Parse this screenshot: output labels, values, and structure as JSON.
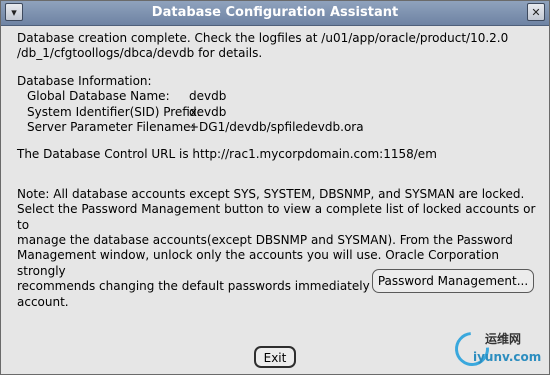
{
  "window": {
    "title": "Database Configuration Assistant"
  },
  "titlebar": {
    "menu_icon": "window-menu-icon",
    "close_icon": "close-icon"
  },
  "message": {
    "line1": "Database creation complete. Check the logfiles at /u01/app/oracle/product/10.2.0",
    "line2": "/db_1/cfgtoollogs/dbca/devdb for details."
  },
  "db_info": {
    "heading": "Database Information:",
    "rows": [
      {
        "label": "Global Database Name:",
        "value": "devdb"
      },
      {
        "label": "System Identifier(SID) Prefix:",
        "value": "devdb"
      },
      {
        "label": "Server Parameter Filename:",
        "value": "+DG1/devdb/spfiledevdb.ora"
      }
    ]
  },
  "control_url": "The Database Control URL is http://rac1.mycorpdomain.com:1158/em",
  "note": {
    "line1": "Note: All database accounts except SYS, SYSTEM, DBSNMP, and SYSMAN are locked.",
    "line2": "Select the Password Management button to view a complete list of locked accounts or to",
    "line3": "manage the database accounts(except DBSNMP and SYSMAN). From the Password",
    "line4": "Management window, unlock only the accounts you will use. Oracle Corporation strongly",
    "line5": "recommends changing the default passwords immediately after unlocking the account."
  },
  "buttons": {
    "password_management": "Password Management...",
    "exit": "Exit"
  },
  "watermark": {
    "text1": "运维网",
    "text2": "iyunv.com"
  }
}
